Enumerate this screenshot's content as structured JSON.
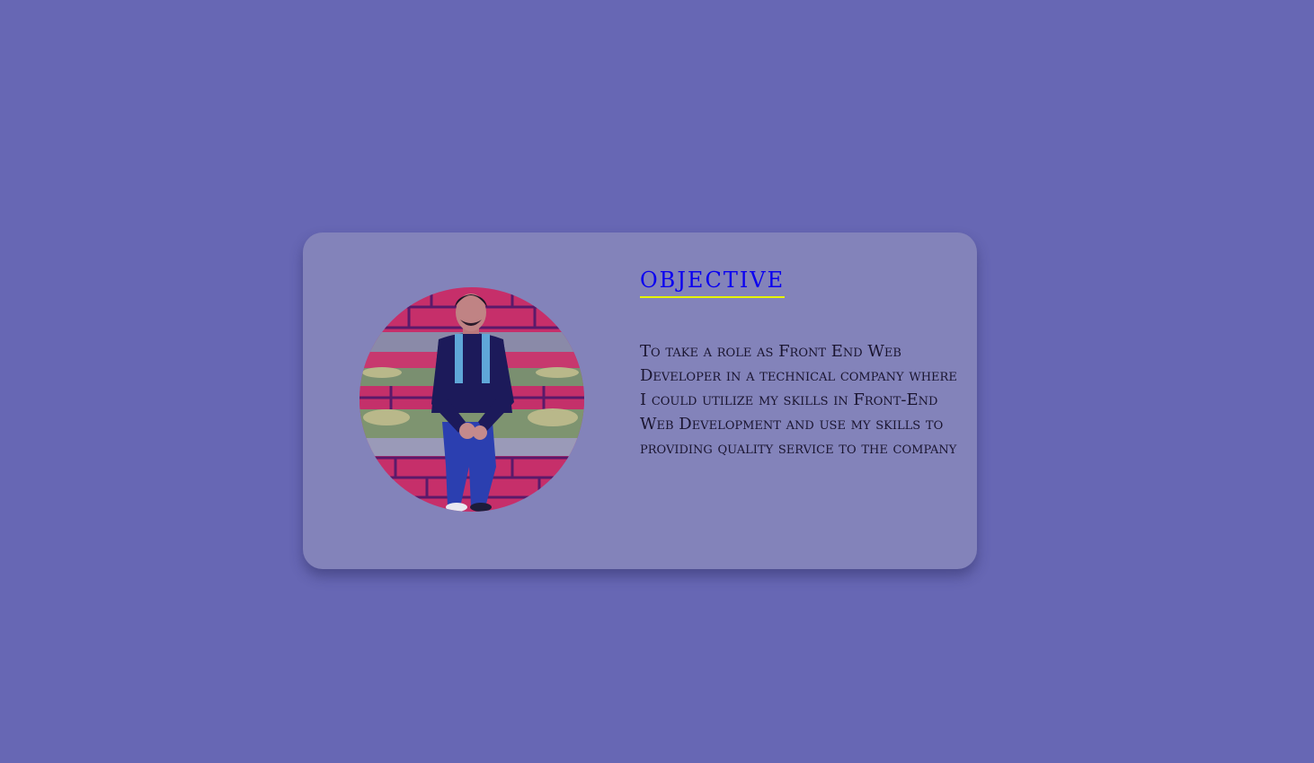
{
  "objective": {
    "heading": "OBJECTIVE",
    "text": "To take a role as Front End Web Developer in a technical company where I could utilize my skills in Front-End Web Development and use my skills to providing quality service to the company",
    "heading_color": "#0a00f0",
    "underline_color": "#e6f500"
  },
  "profile": {
    "photo_icon": "profile-photo"
  },
  "colors": {
    "background": "#6767b4",
    "card": "#8383ba",
    "text": "#1a1530"
  }
}
